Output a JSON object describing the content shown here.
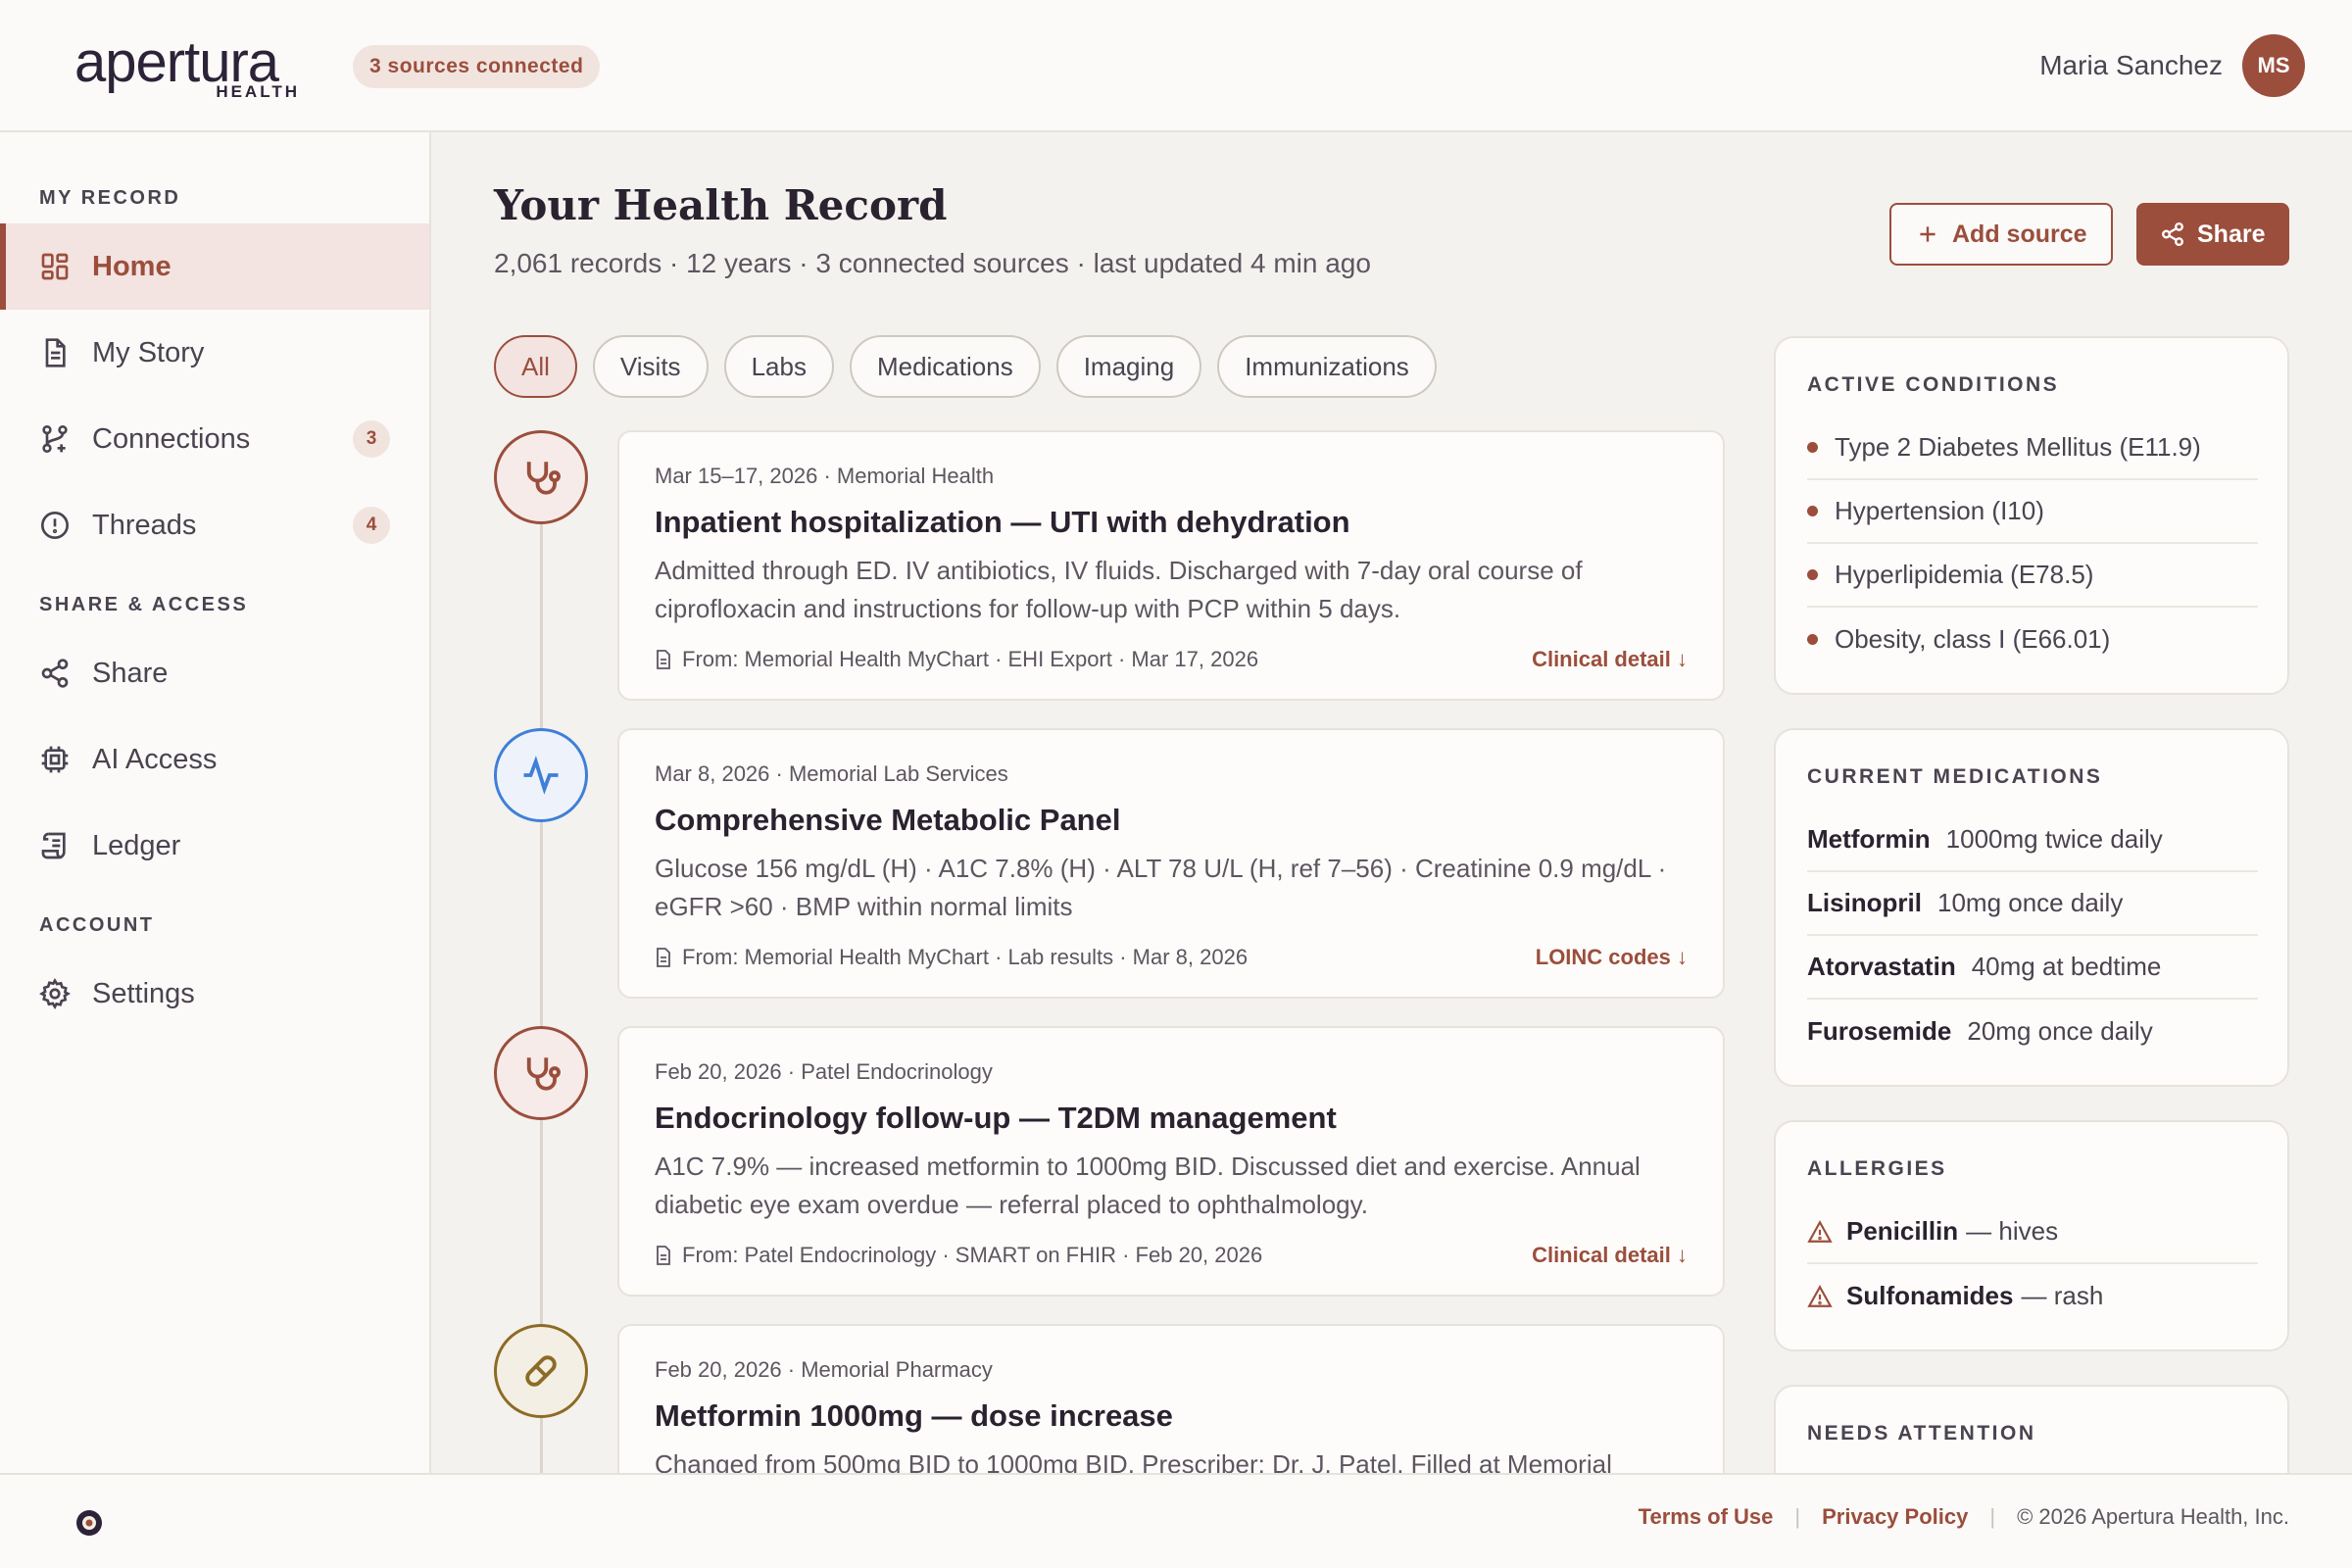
{
  "header": {
    "logo_word": "apertura",
    "logo_sub": "HEALTH",
    "sources_badge": "3 sources connected",
    "user_name": "Maria Sanchez",
    "avatar_initials": "MS"
  },
  "sidebar": {
    "section_record": "MY RECORD",
    "section_share": "SHARE & ACCESS",
    "section_account": "ACCOUNT",
    "items": [
      {
        "label": "Home",
        "icon": "grid-icon",
        "active": true
      },
      {
        "label": "My Story",
        "icon": "document-icon"
      },
      {
        "label": "Connections",
        "icon": "branch-icon",
        "count": "3"
      },
      {
        "label": "Threads",
        "icon": "alert-circle-icon",
        "count": "4"
      },
      {
        "label": "Share",
        "icon": "share-icon"
      },
      {
        "label": "AI Access",
        "icon": "chip-icon"
      },
      {
        "label": "Ledger",
        "icon": "scroll-icon"
      },
      {
        "label": "Settings",
        "icon": "gear-icon"
      }
    ]
  },
  "main": {
    "title": "Your Health Record",
    "subtitle": "2,061 records · 12 years · 3 connected sources · last updated 4 min ago",
    "add_source": "Add source",
    "share": "Share",
    "filters": [
      "All",
      "Visits",
      "Labs",
      "Medications",
      "Imaging",
      "Immunizations"
    ],
    "records": [
      {
        "type": "visit",
        "meta": "Mar 15–17, 2026 · Memorial Health",
        "title": "Inpatient hospitalization — UTI with dehydration",
        "desc": "Admitted through ED. IV antibiotics, IV fluids. Discharged with 7-day oral course of ciprofloxacin and instructions for follow-up with PCP within 5 days.",
        "source": "From: Memorial Health MyChart · EHI Export · Mar 17, 2026",
        "action": "Clinical detail ↓"
      },
      {
        "type": "lab",
        "meta": "Mar 8, 2026 · Memorial Lab Services",
        "title": "Comprehensive Metabolic Panel",
        "desc": "Glucose 156 mg/dL (H) · A1C 7.8% (H) · ALT 78 U/L (H, ref 7–56) · Creatinine 0.9 mg/dL · eGFR >60 · BMP within normal limits",
        "source": "From: Memorial Health MyChart · Lab results · Mar 8, 2026",
        "action": "LOINC codes ↓"
      },
      {
        "type": "visit",
        "meta": "Feb 20, 2026 · Patel Endocrinology",
        "title": "Endocrinology follow-up — T2DM management",
        "desc": "A1C 7.9% — increased metformin to 1000mg BID. Discussed diet and exercise. Annual diabetic eye exam overdue — referral placed to ophthalmology.",
        "source": "From: Patel Endocrinology · SMART on FHIR · Feb 20, 2026",
        "action": "Clinical detail ↓"
      },
      {
        "type": "med",
        "meta": "Feb 20, 2026 · Memorial Pharmacy",
        "title": "Metformin 1000mg — dose increase",
        "desc": "Changed from 500mg BID to 1000mg BID. Prescriber: Dr. J. Patel. Filled at Memorial",
        "source": "",
        "action": ""
      }
    ]
  },
  "panels": {
    "conditions": {
      "heading": "ACTIVE CONDITIONS",
      "items": [
        "Type 2 Diabetes Mellitus (E11.9)",
        "Hypertension (I10)",
        "Hyperlipidemia (E78.5)",
        "Obesity, class I (E66.01)"
      ]
    },
    "medications": {
      "heading": "CURRENT MEDICATIONS",
      "items": [
        {
          "name": "Metformin",
          "dose": "1000mg twice daily"
        },
        {
          "name": "Lisinopril",
          "dose": "10mg once daily"
        },
        {
          "name": "Atorvastatin",
          "dose": "40mg at bedtime"
        },
        {
          "name": "Furosemide",
          "dose": "20mg once daily"
        }
      ]
    },
    "allergies": {
      "heading": "ALLERGIES",
      "items": [
        {
          "name": "Penicillin",
          "reaction": "— hives"
        },
        {
          "name": "Sulfonamides",
          "reaction": "— rash"
        }
      ]
    },
    "attention": {
      "heading": "NEEDS ATTENTION"
    }
  },
  "footer": {
    "terms": "Terms of Use",
    "sep": "|",
    "privacy": "Privacy Policy",
    "copyright": "© 2026 Apertura Health, Inc."
  }
}
